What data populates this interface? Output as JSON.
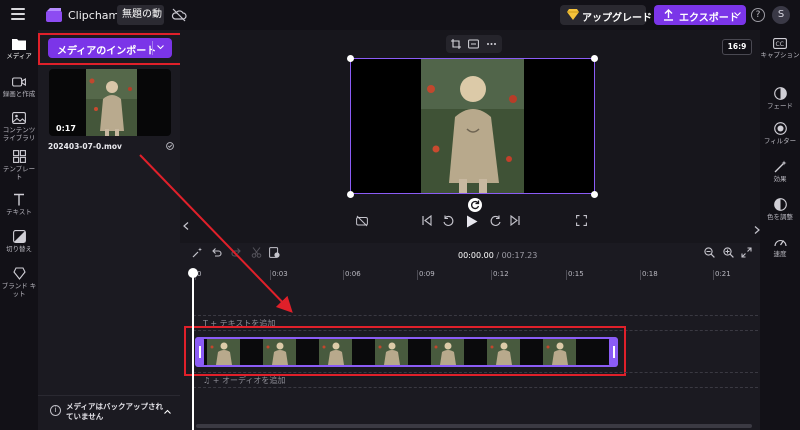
{
  "app": {
    "name": "Clipchamp",
    "project_name": "無題の動",
    "upgrade_label": "アップグレード",
    "export_label": "エクスポート",
    "help_label": "?",
    "avatar_letter": "S"
  },
  "left_nav": [
    {
      "id": "media",
      "label": "メディア",
      "icon": "folder-icon"
    },
    {
      "id": "record",
      "label": "録画と作成",
      "icon": "video-record-icon"
    },
    {
      "id": "library",
      "label": "コンテンツ ライブラリ",
      "icon": "content-library-icon"
    },
    {
      "id": "templates",
      "label": "テンプレート",
      "icon": "templates-icon"
    },
    {
      "id": "text",
      "label": "テキスト",
      "icon": "text-icon"
    },
    {
      "id": "transitions",
      "label": "切り替え",
      "icon": "transitions-icon"
    },
    {
      "id": "brandkit",
      "label": "ブランド キット",
      "icon": "brand-kit-icon"
    }
  ],
  "media_panel": {
    "import_label": "メディアのインポート",
    "items": [
      {
        "duration": "0:17",
        "file_name": "202403-07-0.mov"
      }
    ],
    "backup_note": "メディアはバックアップされていません"
  },
  "preview": {
    "aspect_ratio": "16:9"
  },
  "right_rail": [
    {
      "id": "captions",
      "label": "キャプション",
      "icon": "captions-icon"
    },
    {
      "id": "fade",
      "label": "フェード",
      "icon": "fade-icon"
    },
    {
      "id": "filters",
      "label": "フィルター",
      "icon": "filters-icon"
    },
    {
      "id": "effects",
      "label": "効果",
      "icon": "effects-icon"
    },
    {
      "id": "color",
      "label": "色を調整",
      "icon": "color-adjust-icon"
    },
    {
      "id": "speed",
      "label": "速度",
      "icon": "speed-icon"
    }
  ],
  "timeline": {
    "current_time": "00:00.00",
    "total_time": "/ 00:17.23",
    "ruler_ticks": [
      "0",
      "0:03",
      "0:06",
      "0:09",
      "0:12",
      "0:15",
      "0:18",
      "0:21"
    ],
    "text_track_label": "T  +  テキストを追加",
    "audio_track_label": "♫  +  オーディオを追加"
  },
  "colors": {
    "accent": "#7b35e8",
    "selection": "#8b5cf6",
    "annotation_red": "#e0202a",
    "background": "#17161c"
  }
}
